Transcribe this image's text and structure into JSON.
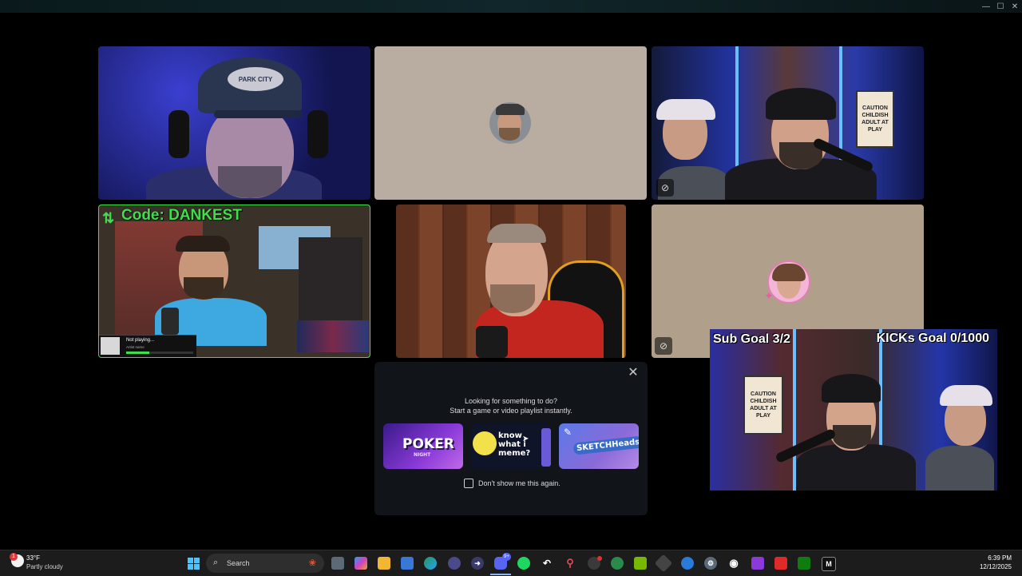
{
  "window": {
    "controls": [
      "—",
      "☐",
      "✕"
    ]
  },
  "tiles": {
    "cam1": {
      "cap_text": "PARK CITY"
    },
    "cam3": {
      "sign_text": "CAUTION CHILDISH ADULT AT PLAY"
    },
    "cam4": {
      "code_text": "Code: DANKEST",
      "now_playing_title": "Not playing...",
      "now_playing_artist": "Artist name"
    },
    "stream": {
      "sub_goal": "Sub Goal 3/2",
      "kicks_goal": "KICKs Goal 0/1000",
      "sign_text": "CAUTION CHILDISH ADULT AT PLAY"
    }
  },
  "activity_popup": {
    "line1": "Looking for something to do?",
    "line2": "Start a game or video playlist instantly.",
    "activities": [
      {
        "name": "POKER",
        "sub": "NIGHT"
      },
      {
        "name": "know what i meme?"
      },
      {
        "name": "SKETCHHeads"
      }
    ],
    "dont_show": "Don't show me this again."
  },
  "taskbar": {
    "weather_temp": "33°F",
    "weather_desc": "Partly cloudy",
    "weather_badge": "1",
    "search_placeholder": "Search",
    "discord_badge": "9+",
    "time": "6:39 PM",
    "date": "12/12/2025"
  },
  "colors": {
    "accent_green": "#3ee04a",
    "discord_blurple": "#5865f2",
    "placeholder_tile": "#b9ada1"
  }
}
